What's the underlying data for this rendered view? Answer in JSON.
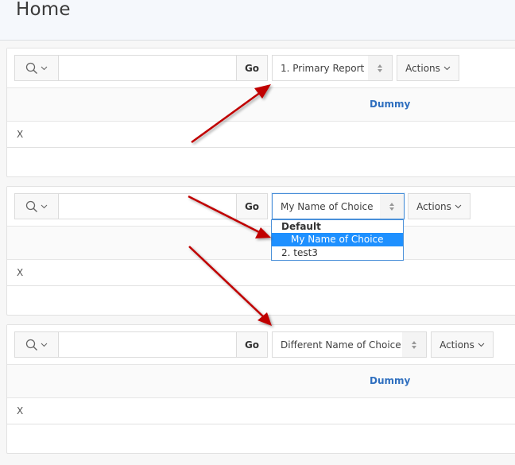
{
  "page": {
    "title": "Home"
  },
  "colors": {
    "accent_blue": "#2f6fbf",
    "selected_option": "#1e90ff",
    "focus_border": "#4a90d9",
    "annotation_arrow": "#c00000"
  },
  "regions": [
    {
      "search": {
        "icon": "search-icon",
        "placeholder": "",
        "value": ""
      },
      "go_label": "Go",
      "report_select": {
        "selected": "1. Primary Report"
      },
      "actions_label": "Actions",
      "columns": [
        "Dummy"
      ],
      "rows": [
        [
          "X"
        ]
      ]
    },
    {
      "search": {
        "icon": "search-icon",
        "placeholder": "",
        "value": ""
      },
      "go_label": "Go",
      "report_select": {
        "selected": "My Name of Choice",
        "open": true,
        "group_label": "Default",
        "options": [
          {
            "label": "My Name of Choice",
            "selected": true
          },
          {
            "label": "2. test3",
            "selected": false
          }
        ]
      },
      "actions_label": "Actions",
      "columns": [
        ""
      ],
      "rows": [
        [
          "X"
        ]
      ]
    },
    {
      "search": {
        "icon": "search-icon",
        "placeholder": "",
        "value": ""
      },
      "go_label": "Go",
      "report_select": {
        "selected": "Different Name of Choice"
      },
      "actions_label": "Actions",
      "columns": [
        "Dummy"
      ],
      "rows": [
        [
          "X"
        ]
      ]
    }
  ],
  "annotations": {
    "arrows": [
      {
        "description": "arrow pointing to first report select"
      },
      {
        "description": "arrow pointing to open dropdown option"
      },
      {
        "description": "arrow pointing to third report select"
      }
    ]
  }
}
